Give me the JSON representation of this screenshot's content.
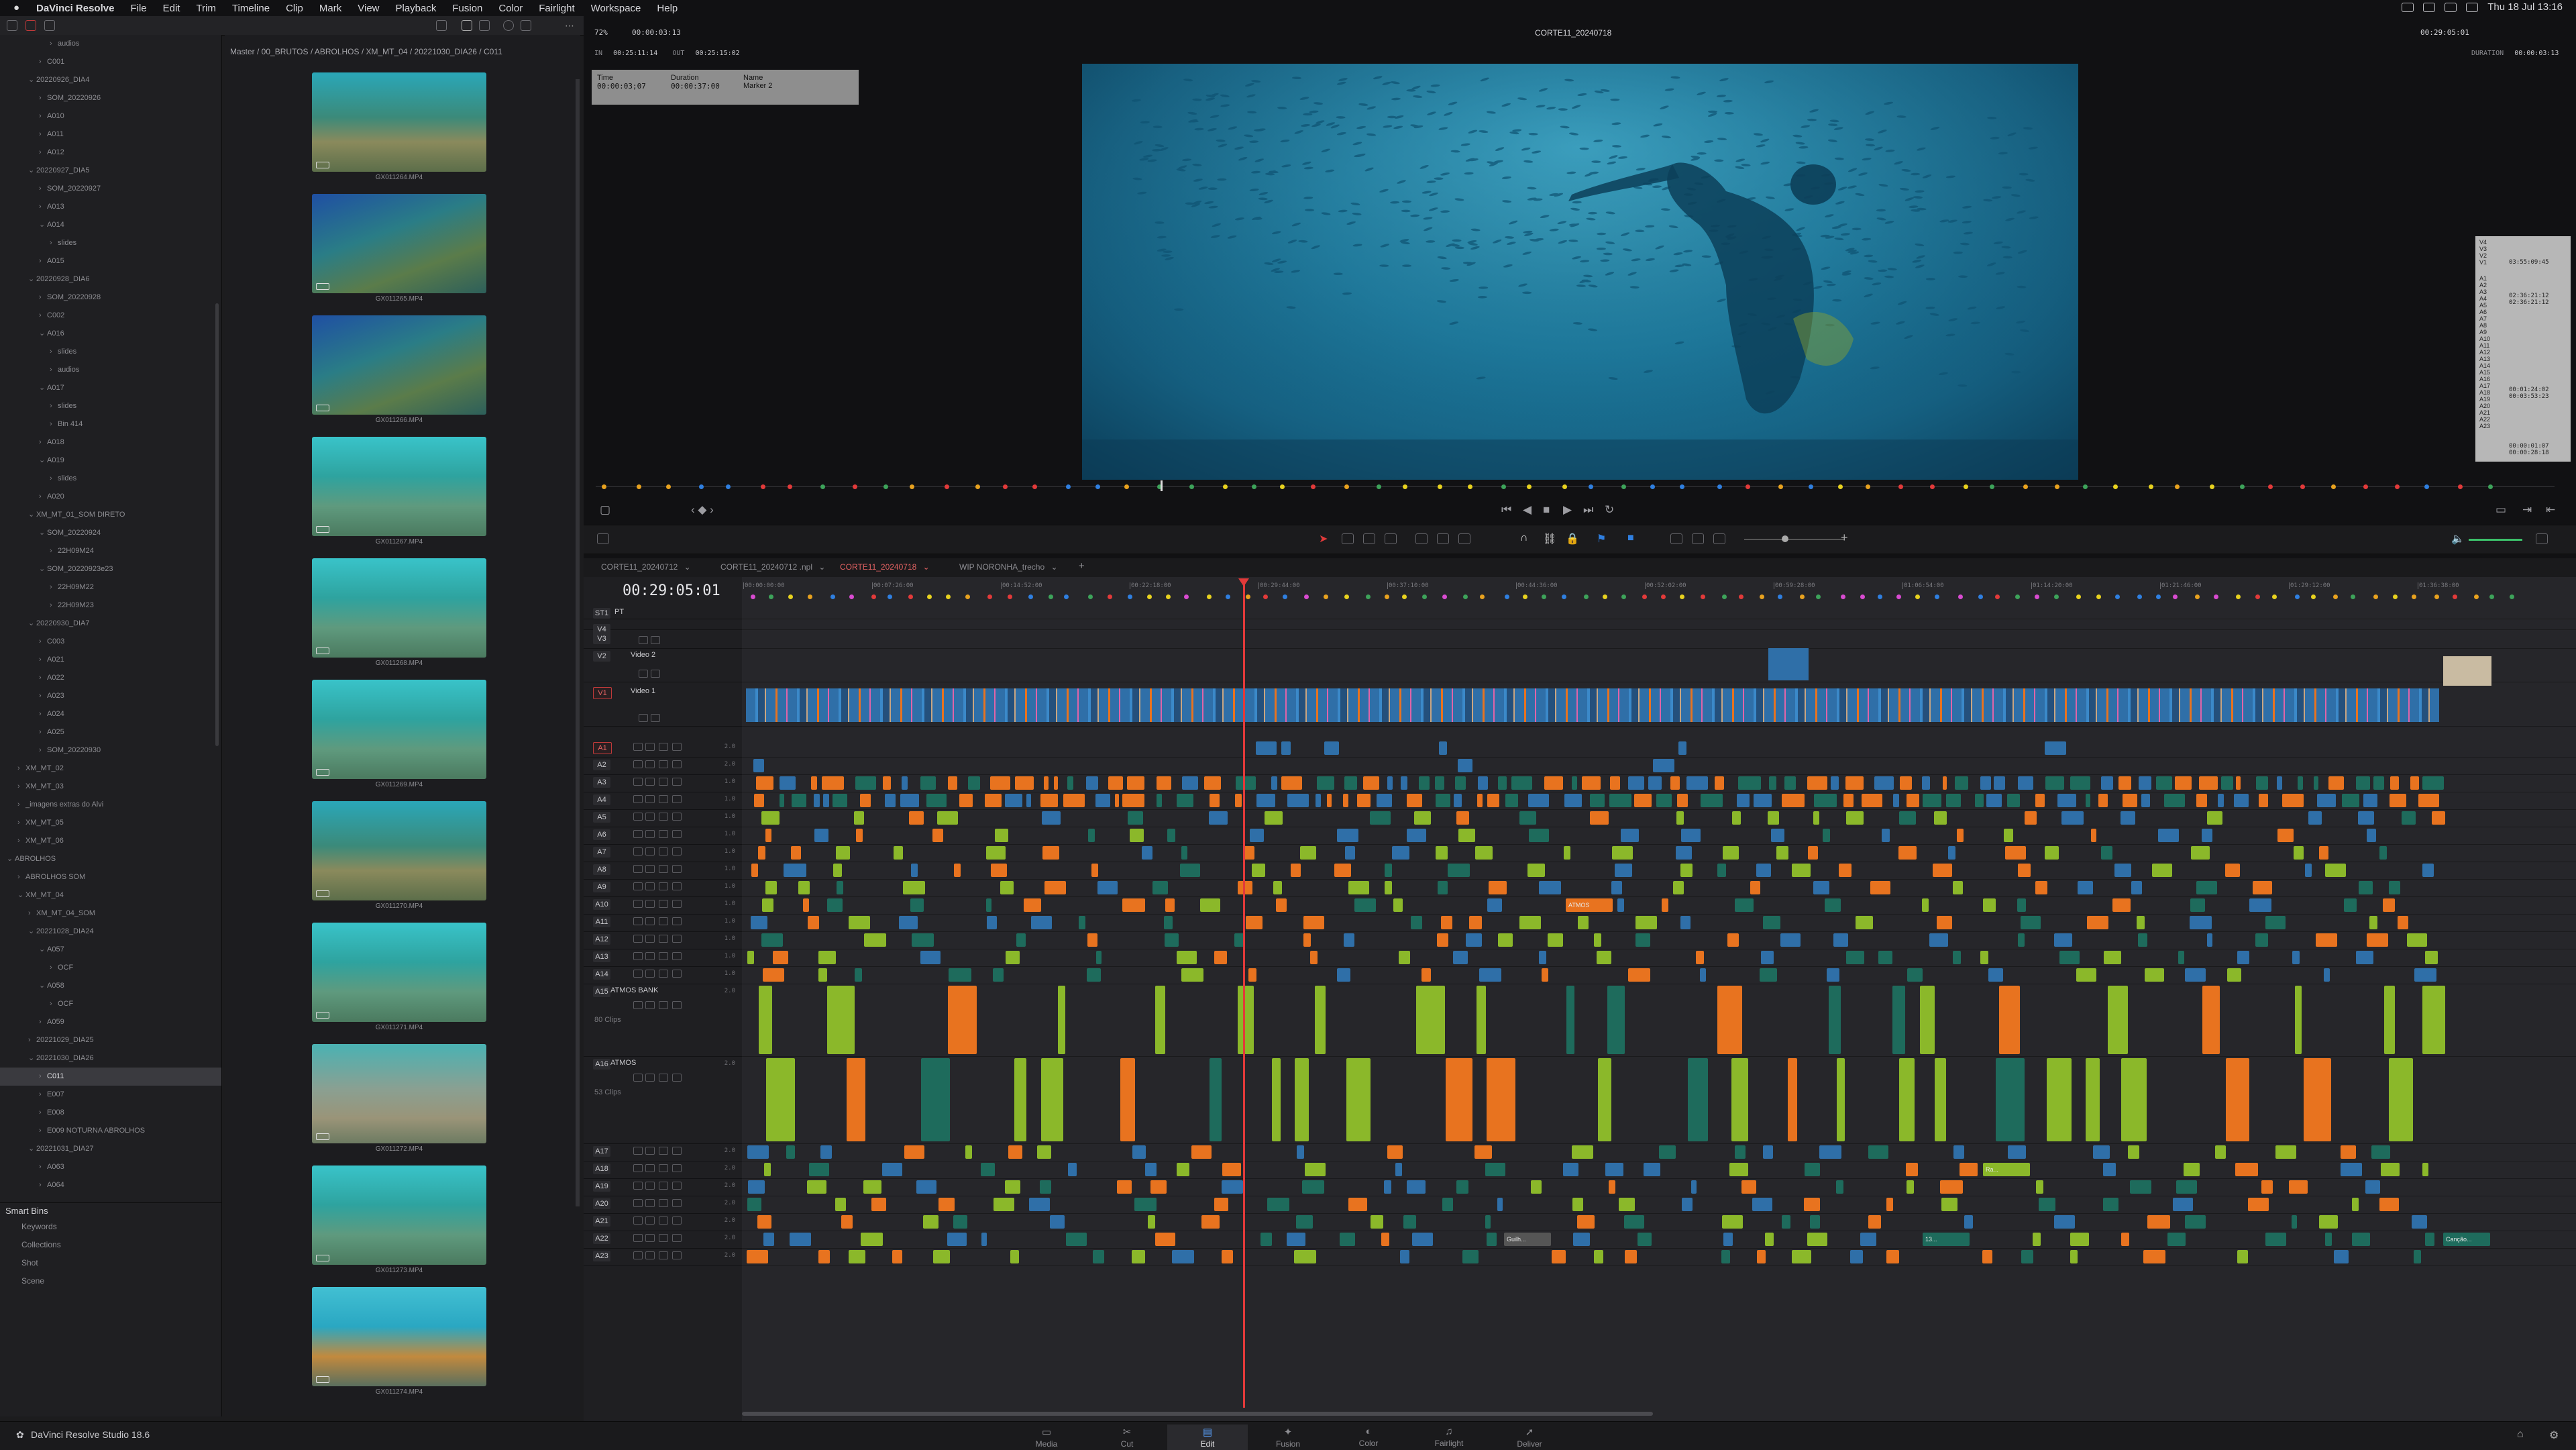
{
  "menubar": {
    "app": "DaVinci Resolve",
    "items": [
      "File",
      "Edit",
      "Trim",
      "Timeline",
      "Clip",
      "Mark",
      "View",
      "Playback",
      "Fusion",
      "Color",
      "Fairlight",
      "Workspace",
      "Help"
    ],
    "datetime": "Thu 18 Jul 13:16"
  },
  "bin_tree": {
    "rows": [
      {
        "label": "audios",
        "indent": 4
      },
      {
        "label": "C001",
        "indent": 3
      },
      {
        "label": "20220926_DIA4",
        "indent": 2,
        "open": true
      },
      {
        "label": "SOM_20220926",
        "indent": 3
      },
      {
        "label": "A010",
        "indent": 3
      },
      {
        "label": "A011",
        "indent": 3
      },
      {
        "label": "A012",
        "indent": 3
      },
      {
        "label": "20220927_DIA5",
        "indent": 2,
        "open": true
      },
      {
        "label": "SOM_20220927",
        "indent": 3
      },
      {
        "label": "A013",
        "indent": 3
      },
      {
        "label": "A014",
        "indent": 3,
        "open": true
      },
      {
        "label": "slides",
        "indent": 4
      },
      {
        "label": "A015",
        "indent": 3
      },
      {
        "label": "20220928_DIA6",
        "indent": 2,
        "open": true
      },
      {
        "label": "SOM_20220928",
        "indent": 3
      },
      {
        "label": "C002",
        "indent": 3
      },
      {
        "label": "A016",
        "indent": 3,
        "open": true
      },
      {
        "label": "slides",
        "indent": 4
      },
      {
        "label": "audios",
        "indent": 4
      },
      {
        "label": "A017",
        "indent": 3,
        "open": true
      },
      {
        "label": "slides",
        "indent": 4
      },
      {
        "label": "Bin 414",
        "indent": 4
      },
      {
        "label": "A018",
        "indent": 3
      },
      {
        "label": "A019",
        "indent": 3,
        "open": true
      },
      {
        "label": "slides",
        "indent": 4
      },
      {
        "label": "A020",
        "indent": 3
      },
      {
        "label": "XM_MT_01_SOM DIRETO",
        "indent": 2,
        "open": true
      },
      {
        "label": "SOM_20220924",
        "indent": 3,
        "open": true
      },
      {
        "label": "22H09M24",
        "indent": 4
      },
      {
        "label": "SOM_20220923e23",
        "indent": 3,
        "open": true
      },
      {
        "label": "22H09M22",
        "indent": 4
      },
      {
        "label": "22H09M23",
        "indent": 4
      },
      {
        "label": "20220930_DIA7",
        "indent": 2,
        "open": true
      },
      {
        "label": "C003",
        "indent": 3
      },
      {
        "label": "A021",
        "indent": 3
      },
      {
        "label": "A022",
        "indent": 3
      },
      {
        "label": "A023",
        "indent": 3
      },
      {
        "label": "A024",
        "indent": 3
      },
      {
        "label": "A025",
        "indent": 3
      },
      {
        "label": "SOM_20220930",
        "indent": 3
      },
      {
        "label": "XM_MT_02",
        "indent": 1
      },
      {
        "label": "XM_MT_03",
        "indent": 1
      },
      {
        "label": "_imagens extras do Alvi",
        "indent": 1
      },
      {
        "label": "XM_MT_05",
        "indent": 1
      },
      {
        "label": "XM_MT_06",
        "indent": 1
      },
      {
        "label": "ABROLHOS",
        "indent": 0,
        "open": true
      },
      {
        "label": "ABROLHOS SOM",
        "indent": 1
      },
      {
        "label": "XM_MT_04",
        "indent": 1,
        "open": true
      },
      {
        "label": "XM_MT_04_SOM",
        "indent": 2
      },
      {
        "label": "20221028_DIA24",
        "indent": 2,
        "open": true
      },
      {
        "label": "A057",
        "indent": 3,
        "open": true
      },
      {
        "label": "OCF",
        "indent": 4
      },
      {
        "label": "A058",
        "indent": 3,
        "open": true
      },
      {
        "label": "OCF",
        "indent": 4
      },
      {
        "label": "A059",
        "indent": 3
      },
      {
        "label": "20221029_DIA25",
        "indent": 2
      },
      {
        "label": "20221030_DIA26",
        "indent": 2,
        "open": true
      },
      {
        "label": "C011",
        "indent": 3,
        "selected": true
      },
      {
        "label": "E007",
        "indent": 3
      },
      {
        "label": "E008",
        "indent": 3
      },
      {
        "label": "E009 NOTURNA ABROLHOS",
        "indent": 3
      },
      {
        "label": "20221031_DIA27",
        "indent": 2,
        "open": true
      },
      {
        "label": "A063",
        "indent": 3
      },
      {
        "label": "A064",
        "indent": 3
      }
    ]
  },
  "smart_bins": {
    "title": "Smart Bins",
    "items": [
      "Keywords",
      "Collections",
      "Shot",
      "Scene"
    ]
  },
  "media_pool": {
    "path": "Master / 00_BRUTOS / ABROLHOS / XM_MT_04 / 20221030_DIA26 / C011",
    "clips": [
      {
        "name": "GX011264.MP4",
        "tone": "reef"
      },
      {
        "name": "GX011265.MP4",
        "tone": "blue"
      },
      {
        "name": "GX011266.MP4",
        "tone": "blue"
      },
      {
        "name": "GX011267.MP4",
        "tone": "teal"
      },
      {
        "name": "GX011268.MP4",
        "tone": "teal"
      },
      {
        "name": "GX011269.MP4",
        "tone": "teal"
      },
      {
        "name": "GX011270.MP4",
        "tone": "reef"
      },
      {
        "name": "GX011271.MP4",
        "tone": "teal"
      },
      {
        "name": "GX011272.MP4",
        "tone": "sand"
      },
      {
        "name": "GX011273.MP4",
        "tone": "teal"
      },
      {
        "name": "GX011274.MP4",
        "tone": "coral"
      }
    ]
  },
  "viewer": {
    "zoom": "72%",
    "tc_left": "00:00:03:13",
    "timeline_name": "CORTE11_20240718",
    "tc_right": "00:29:05:01",
    "in_label": "IN",
    "in_tc": "00:25:11:14",
    "out_label": "OUT",
    "out_tc": "00:25:15:02",
    "duration_label": "DURATION",
    "duration_tc": "00:00:03:13",
    "marker": {
      "time_label": "Time",
      "time": "00:00:03;07",
      "duration_label": "Duration",
      "duration": "00:00:37:00",
      "name_label": "Name",
      "name": "Marker 2"
    },
    "track_panel": {
      "video": [
        "V4",
        "V3",
        "V2",
        "V1"
      ],
      "video_tc": "03:55:09:45",
      "audio": [
        "A1",
        "A2",
        "A3",
        "A4",
        "A5",
        "A6",
        "A7",
        "A8",
        "A9",
        "A10",
        "A11",
        "A12",
        "A13",
        "A14",
        "A15",
        "A16",
        "A17",
        "A18",
        "A19",
        "A20",
        "A21",
        "A22",
        "A23"
      ],
      "tc1": "02:36:21:12",
      "tc2": "02:36:21:12",
      "tc3": "00:01:24:02",
      "tc4": "00:03:53:23",
      "tc5": "00:00:01:07",
      "tc6": "00:00:28:18"
    }
  },
  "timeline": {
    "timecode": "00:29:05:01",
    "tabs": [
      {
        "label": "CORTE11_20240712",
        "active": false
      },
      {
        "label": "CORTE11_20240712 .npl",
        "active": false
      },
      {
        "label": "CORTE11_20240718",
        "active": true
      },
      {
        "label": "WIP NORONHA_trecho",
        "active": false
      }
    ],
    "ruler_ticks": [
      "00:00:00:00",
      "00:07:26:00",
      "00:14:52:00",
      "00:22:18:00",
      "00:29:44:00",
      "00:37:10:00",
      "00:44:36:00",
      "00:52:02:00",
      "00:59:28:00",
      "01:06:54:00",
      "01:14:20:00",
      "01:21:46:00",
      "01:29:12:00",
      "01:36:38:00"
    ],
    "subtitle_track": {
      "name": "ST1",
      "label": "PT"
    },
    "video_tracks": [
      {
        "name": "V4",
        "label": ""
      },
      {
        "name": "V3",
        "label": ""
      },
      {
        "name": "V2",
        "label": "Video 2"
      },
      {
        "name": "V1",
        "label": "Video 1"
      }
    ],
    "audio_tracks": [
      {
        "name": "A1",
        "label": "",
        "vol": "2.0"
      },
      {
        "name": "A2",
        "label": "",
        "vol": "2.0"
      },
      {
        "name": "A3",
        "label": "",
        "vol": "1.0"
      },
      {
        "name": "A4",
        "label": "",
        "vol": "1.0"
      },
      {
        "name": "A5",
        "label": "",
        "vol": "1.0"
      },
      {
        "name": "A6",
        "label": "",
        "vol": "1.0"
      },
      {
        "name": "A7",
        "label": "",
        "vol": "1.0"
      },
      {
        "name": "A8",
        "label": "",
        "vol": "1.0"
      },
      {
        "name": "A9",
        "label": "",
        "vol": "1.0"
      },
      {
        "name": "A10",
        "label": "",
        "vol": "1.0"
      },
      {
        "name": "A11",
        "label": "",
        "vol": "1.0"
      },
      {
        "name": "A12",
        "label": "",
        "vol": "1.0"
      },
      {
        "name": "A13",
        "label": "",
        "vol": "1.0"
      },
      {
        "name": "A14",
        "label": "",
        "vol": "1.0"
      },
      {
        "name": "A15",
        "label": "ATMOS BANK",
        "vol": "2.0",
        "clips": "80 Clips"
      },
      {
        "name": "A16",
        "label": "ATMOS",
        "vol": "2.0",
        "clips": "53 Clips"
      },
      {
        "name": "A17",
        "label": "",
        "vol": "2.0"
      },
      {
        "name": "A18",
        "label": "",
        "vol": "2.0"
      },
      {
        "name": "A19",
        "label": "",
        "vol": "2.0"
      },
      {
        "name": "A20",
        "label": "",
        "vol": "2.0"
      },
      {
        "name": "A21",
        "label": "",
        "vol": "2.0"
      },
      {
        "name": "A22",
        "label": "",
        "vol": "2.0"
      },
      {
        "name": "A23",
        "label": "",
        "vol": "2.0"
      }
    ],
    "clip_labels": [
      "Ra...",
      "Canção...",
      "Guilh...",
      "ATMOS",
      "13..."
    ]
  },
  "pagebar": {
    "brand": "DaVinci Resolve Studio 18.6",
    "pages": [
      {
        "label": "Media",
        "icon": "▭"
      },
      {
        "label": "Cut",
        "icon": "✂"
      },
      {
        "label": "Edit",
        "icon": "▤",
        "active": true
      },
      {
        "label": "Fusion",
        "icon": "✦"
      },
      {
        "label": "Color",
        "icon": "◐"
      },
      {
        "label": "Fairlight",
        "icon": "♫"
      },
      {
        "label": "Deliver",
        "icon": "➚"
      }
    ]
  },
  "colors": {
    "accent": "#e23a3a",
    "clip_blue": "#2f6fa8",
    "clip_orange": "#e8731f",
    "clip_teal": "#1e6b5c",
    "clip_lime": "#8bb82a",
    "clip_tan": "#c9a581"
  }
}
